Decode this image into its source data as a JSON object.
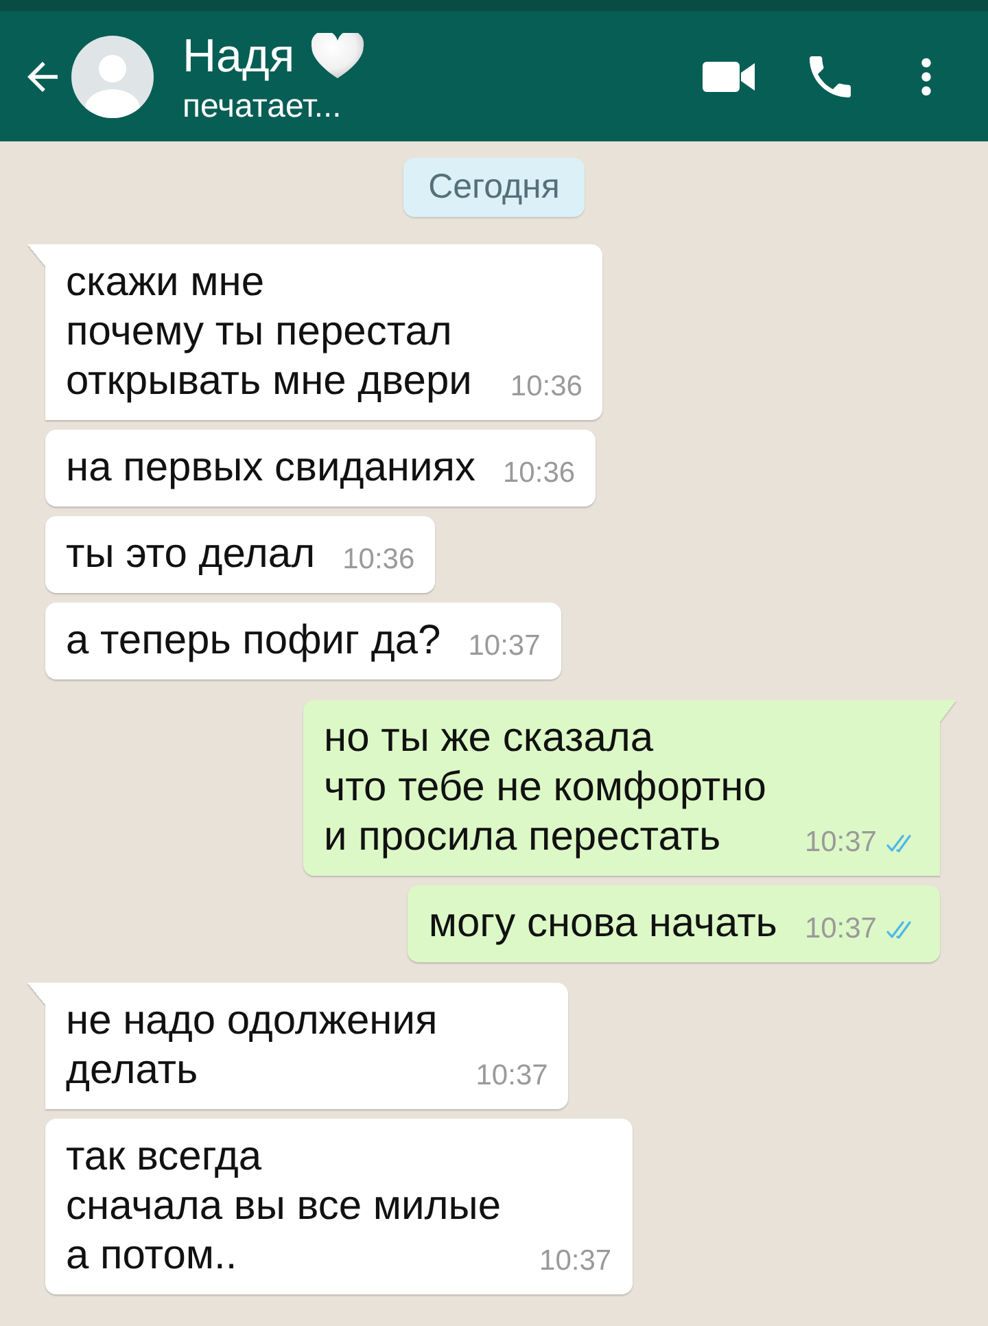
{
  "header": {
    "name": "Надя",
    "status": "печатает..."
  },
  "date_chip": "Сегодня",
  "messages": [
    {
      "kind": "incoming",
      "tail": true,
      "text": "скажи мне\nпочему ты перестал\nоткрывать мне двери",
      "time": "10:36"
    },
    {
      "kind": "incoming",
      "tail": false,
      "text": "на первых свиданиях",
      "time": "10:36"
    },
    {
      "kind": "incoming",
      "tail": false,
      "text": "ты это делал",
      "time": "10:36"
    },
    {
      "kind": "incoming",
      "tail": false,
      "text": "а теперь пофиг да?",
      "time": "10:37"
    },
    {
      "kind": "outgoing",
      "tail": true,
      "text": "но ты же сказала\nчто тебе не комфортно\nи просила перестать",
      "time": "10:37",
      "read": true
    },
    {
      "kind": "outgoing",
      "tail": false,
      "text": "могу снова начать",
      "time": "10:37",
      "read": true
    },
    {
      "kind": "incoming",
      "tail": true,
      "text": "не надо одолжения\nделать",
      "time": "10:37"
    },
    {
      "kind": "incoming",
      "tail": false,
      "text": "так всегда\nсначала вы все милые\nа потом..",
      "time": "10:37"
    }
  ]
}
